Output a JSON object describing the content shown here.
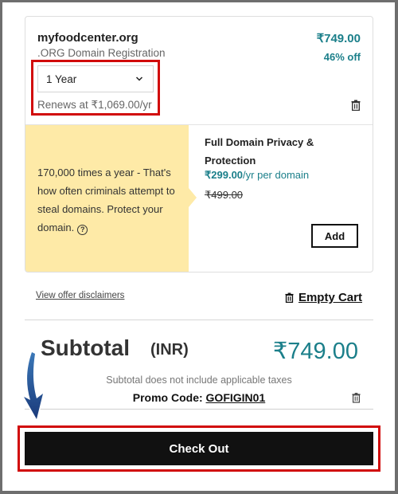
{
  "cart_item": {
    "domain_name": "myfoodcenter.org",
    "product_type": ".ORG Domain Registration",
    "price": "₹749.00",
    "discount": "46% off",
    "term_select": {
      "selected": "1 Year"
    },
    "renewal_text": "Renews at ₹1,069.00/yr",
    "remove_icon": "trash-icon"
  },
  "upsell": {
    "pitch_text": "170,000 times a year -  That's how often criminals attempt to steal domains. Protect your domain.",
    "help_icon_glyph": "?",
    "title": "Full Domain Privacy & Protection",
    "price": "₹299.00",
    "price_suffix": "/yr per domain",
    "original_price": "₹499.00",
    "add_label": "Add"
  },
  "links": {
    "disclaimers": "View offer disclaimers",
    "empty_cart": "Empty Cart"
  },
  "summary": {
    "subtotal_label": "Subtotal",
    "currency": "(INR)",
    "subtotal_amount": "₹749.00",
    "tax_note": "Subtotal does not include applicable taxes",
    "promo_label": "Promo Code: ",
    "promo_code": "GOFIGIN01"
  },
  "checkout": {
    "label": "Check Out"
  },
  "colors": {
    "accent_teal": "#1b7f8a",
    "highlight_red": "#d10a0a",
    "promo_yellow": "#feeaa7",
    "button_dark": "#111111"
  }
}
